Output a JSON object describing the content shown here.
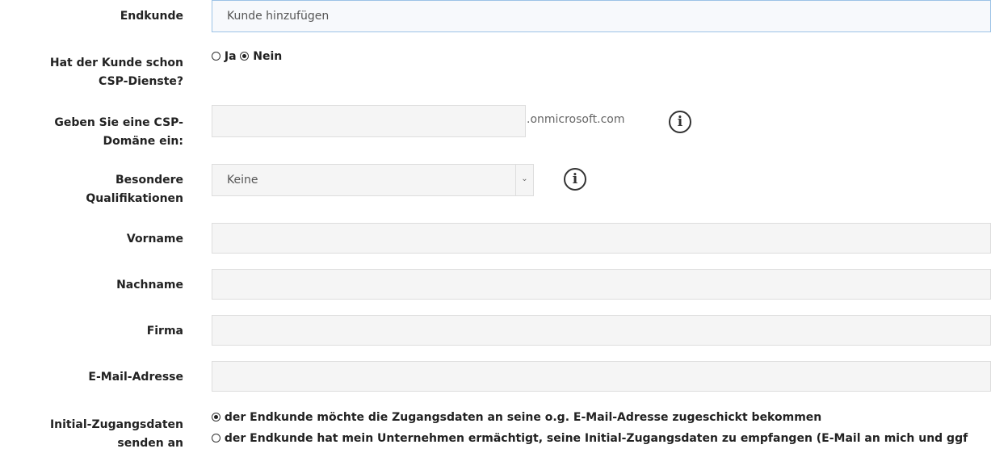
{
  "form": {
    "endkunde": {
      "label": "Endkunde",
      "value": "Kunde hinzufügen"
    },
    "csp_services": {
      "label": "Hat der Kunde schon CSP-Dienste?",
      "option_ja": "Ja",
      "option_nein": "Nein",
      "selected": "Nein"
    },
    "csp_domain": {
      "label": "Geben Sie eine CSP-Domäne ein:",
      "value": "",
      "suffix": ".onmicrosoft.com",
      "info_icon": "info-icon"
    },
    "qualifications": {
      "label": "Besondere Qualifikationen",
      "selected": "Keine",
      "info_icon": "info-icon"
    },
    "vorname": {
      "label": "Vorname",
      "value": ""
    },
    "nachname": {
      "label": "Nachname",
      "value": ""
    },
    "firma": {
      "label": "Firma",
      "value": ""
    },
    "email": {
      "label": "E-Mail-Adresse",
      "value": ""
    },
    "initial_credentials": {
      "label": "Initial-Zugangsdaten senden an",
      "option_1": "der Endkunde möchte die Zugangsdaten an seine o.g. E-Mail-Adresse zugeschickt bekommen",
      "option_2": "der Endkunde hat mein Unternehmen ermächtigt, seine Initial-Zugangsdaten zu empfangen (E-Mail an mich und ggf",
      "selected": "option_1"
    }
  }
}
